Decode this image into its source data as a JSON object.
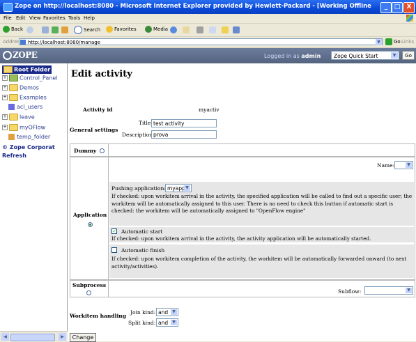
{
  "window": {
    "title": "Zope on http://localhost:8080 - Microsoft Internet Explorer provided by Hewlett-Packard - [Working Offline",
    "min": "_",
    "max": "□",
    "close": "X"
  },
  "menu": [
    "File",
    "Edit",
    "View",
    "Favorites",
    "Tools",
    "Help"
  ],
  "toolbar": {
    "back": "Back",
    "search": "Search",
    "favorites": "Favorites",
    "media": "Media"
  },
  "address": {
    "label": "Address",
    "url": "http://localhost:8080/manage",
    "go": "Go",
    "links": "Links"
  },
  "zope": {
    "logo": "ZOPE",
    "logged_prefix": "Logged in as",
    "user": "admin",
    "quick_start": "Zope Quick Start",
    "go": "Go"
  },
  "tree": {
    "root": "Root Folder",
    "items": [
      "Control_Panel",
      "Demos",
      "Examples",
      "acl_users",
      "leave",
      "myOFlow",
      "temp_folder"
    ],
    "corp": "© Zope Corporat",
    "refresh": "Refresh"
  },
  "form": {
    "heading": "Edit activity",
    "activity_id_label": "Activity id",
    "activity_id": "myactiv",
    "general_settings": "General settings",
    "title_label": "Title:",
    "title_value": "test activity",
    "description_label": "Description:",
    "description_value": "prova",
    "dummy": "Dummy",
    "application": "Application",
    "name_label": "Name:",
    "pushing_label": "Pushing application:",
    "pushing_value": "myapp",
    "pushing_help": "If checked: upon workitem arrival in the activity, the specified application will be called to find out a specific user; the workitem will be automatically assigned to this user. There is no need to check this button if automatic start is checked: the workitem will be automatically assigned to \"OpenFlow engine\"",
    "automatic_start": "Automatic start",
    "automatic_start_checked": true,
    "automatic_start_help": "If checked: upon workitem arrival in the activity, the activity application will be automatically started.",
    "automatic_finish": "Automatic finish",
    "automatic_finish_checked": false,
    "automatic_finish_help": "If checked: upon workitem completion of the activity, the workitem will be automatically forwarded onward (to next activity/activities).",
    "subprocess": "Subprocess",
    "subflow_label": "Subflow:",
    "workitem_handling": "Workitem handling",
    "join_label": "Join kind:",
    "join_value": "and",
    "split_label": "Split kind:",
    "split_value": "and",
    "change": "Change"
  }
}
